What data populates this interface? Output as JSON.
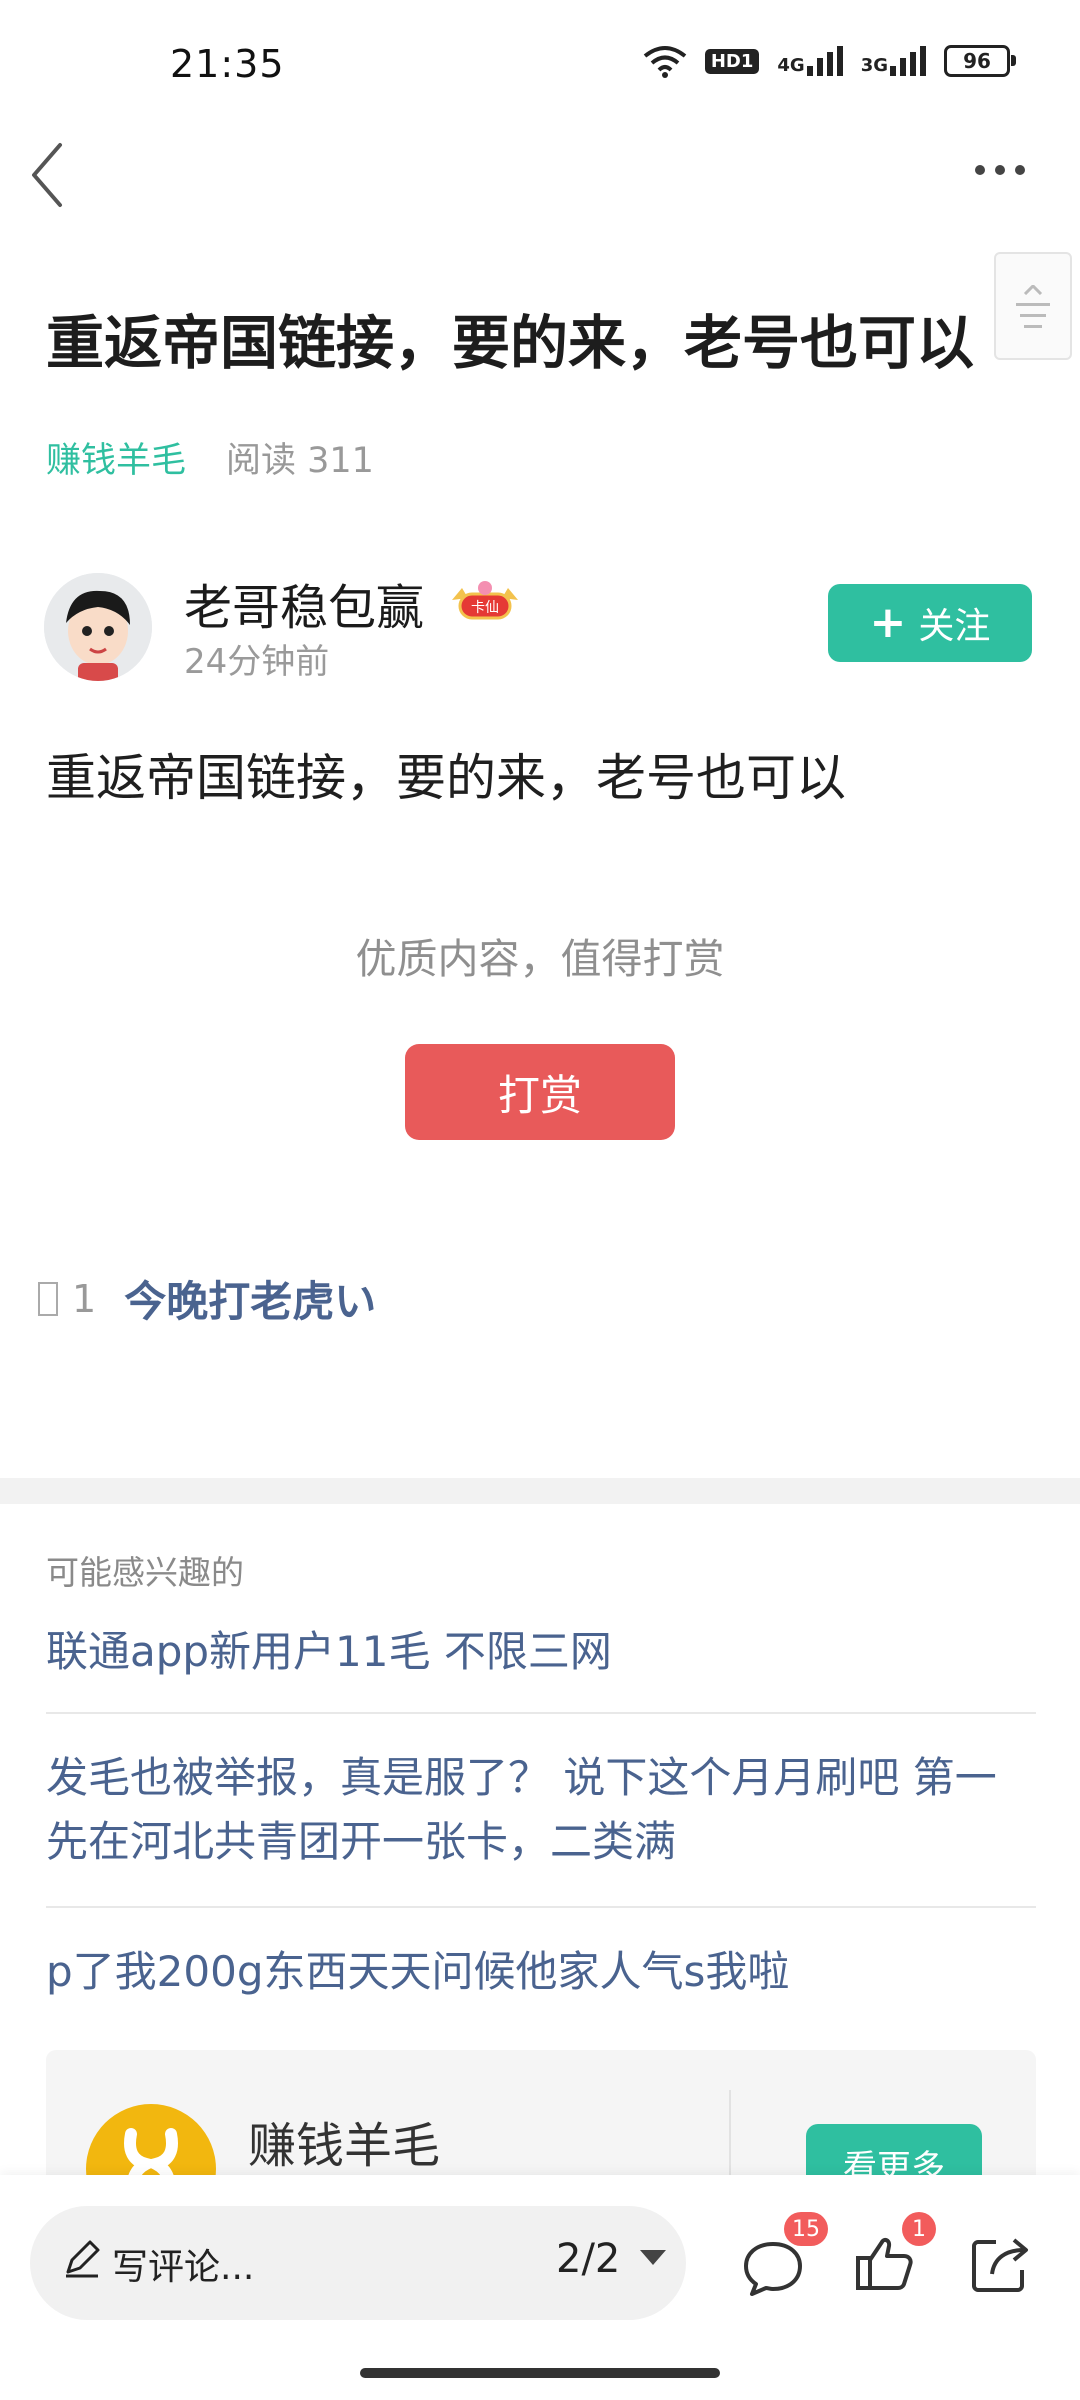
{
  "status_bar": {
    "time": "21:35",
    "hd": "HD1",
    "net1": "4G",
    "net2": "3G",
    "battery": "96"
  },
  "nav": {
    "back_icon": "chevron-left-icon",
    "more_icon": "more-horizontal-icon"
  },
  "article": {
    "title": "重返帝国链接，要的来，老号也可以",
    "category": "赚钱羊毛",
    "reads": "阅读 311",
    "author_name": "老哥稳包赢",
    "author_badge": "卡仙",
    "post_time": "24分钟前",
    "follow_label": "关注",
    "content": "重返帝国链接，要的来，老号也可以",
    "reward_hint": "优质内容，值得打赏",
    "reward_label": "打赏"
  },
  "comments": [
    {
      "index": "1",
      "text": "今晚打老虎い"
    }
  ],
  "related": {
    "header": "可能感兴趣的",
    "items": [
      "联通app新用户11毛 不限三网",
      "发毛也被举报，真是服了？ 说下这个月月刷吧 第一先在河北共青团开一张卡，二类满",
      "p了我200g东西天天问候他家人气s我啦"
    ]
  },
  "forum_card": {
    "name": "赚钱羊毛",
    "more_label": "看更多"
  },
  "bottom_bar": {
    "write_placeholder": "写评论...",
    "page_indicator": "2/2",
    "comment_count": "15",
    "like_count": "1"
  },
  "colors": {
    "accent": "#2fbfa0",
    "reward": "#e85a5a",
    "link": "#4a638f",
    "badge": "#f25c5c"
  }
}
